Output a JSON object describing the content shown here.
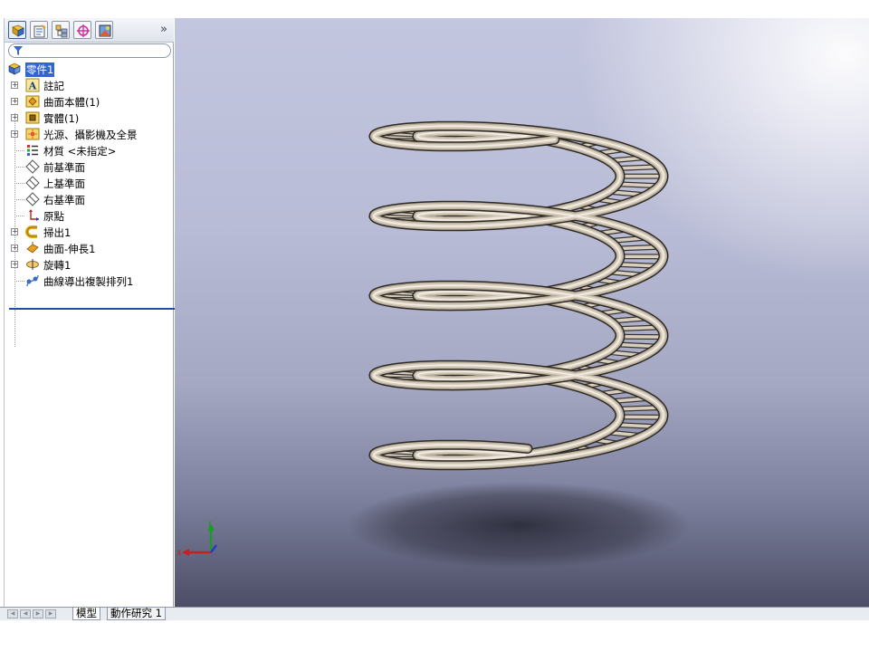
{
  "feature_manager": {
    "tabs": [
      {
        "icon": "feature-manager-icon",
        "active": true
      },
      {
        "icon": "property-manager-icon",
        "active": false
      },
      {
        "icon": "configuration-manager-icon",
        "active": false
      },
      {
        "icon": "dimxpert-icon",
        "active": false
      },
      {
        "icon": "display-manager-icon",
        "active": false
      }
    ],
    "more": "»",
    "tree": {
      "root": "零件1",
      "items": [
        {
          "label": "註記",
          "icon": "annotations-icon",
          "expandable": true
        },
        {
          "label": "曲面本體(1)",
          "icon": "surface-bodies-icon",
          "expandable": true
        },
        {
          "label": "實體(1)",
          "icon": "solid-bodies-icon",
          "expandable": true
        },
        {
          "label": "光源、攝影機及全景",
          "icon": "lights-cameras-icon",
          "expandable": true
        },
        {
          "label": "材質 <未指定>",
          "icon": "material-icon",
          "expandable": false
        },
        {
          "label": "前基準面",
          "icon": "plane-icon",
          "expandable": false
        },
        {
          "label": "上基準面",
          "icon": "plane-icon",
          "expandable": false
        },
        {
          "label": "右基準面",
          "icon": "plane-icon",
          "expandable": false
        },
        {
          "label": "原點",
          "icon": "origin-icon",
          "expandable": false
        },
        {
          "label": "掃出1",
          "icon": "sweep-icon",
          "expandable": true
        },
        {
          "label": "曲面-伸長1",
          "icon": "surface-extrude-icon",
          "expandable": true
        },
        {
          "label": "旋轉1",
          "icon": "revolve-icon",
          "expandable": true
        },
        {
          "label": "曲線導出複製排列1",
          "icon": "curve-pattern-icon",
          "expandable": false
        }
      ]
    }
  },
  "viewport": {
    "model": "helical-ladder-spring",
    "triad": {
      "x": "X",
      "y": "Y"
    },
    "colors": {
      "tube": "#d8cfbf",
      "bg_top": "#c3c6df",
      "bg_bottom": "#4b4d65"
    }
  },
  "bottom_tabs": {
    "model": "模型",
    "motion": "動作研究 1"
  }
}
